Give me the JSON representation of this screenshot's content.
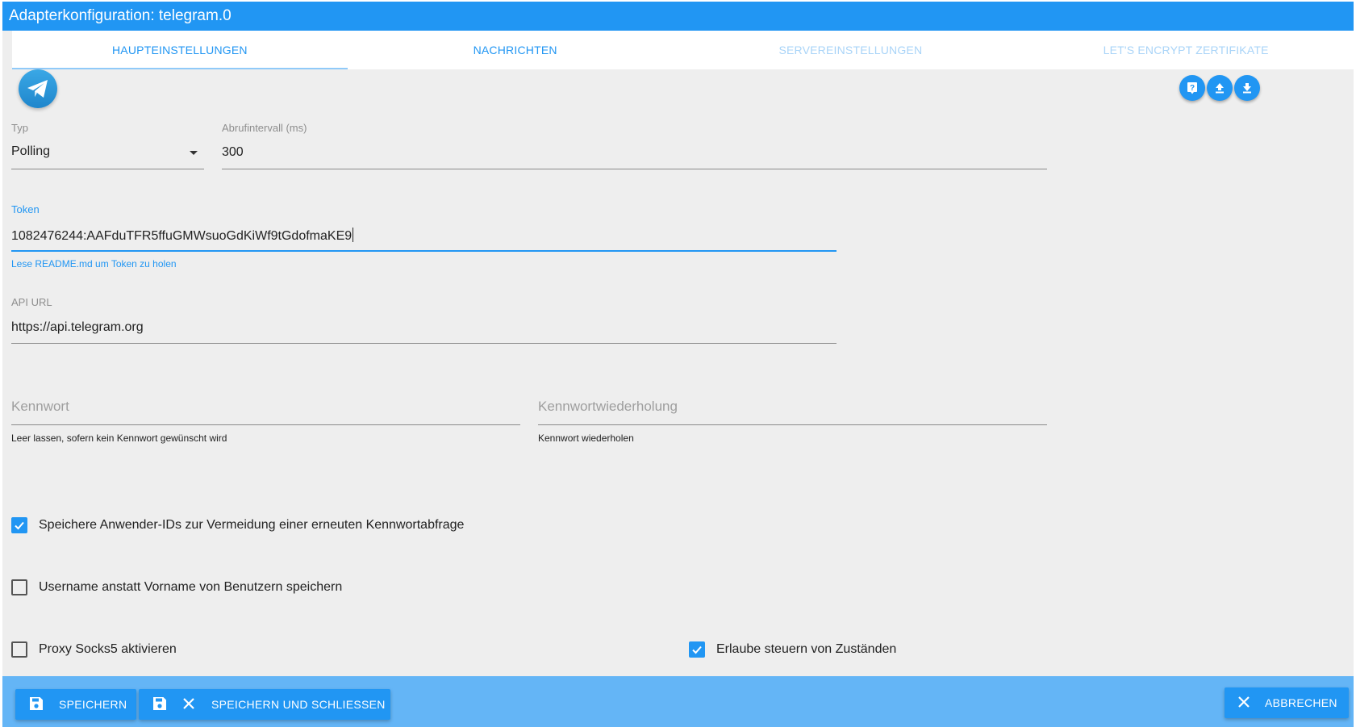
{
  "window": {
    "title": "Adapterkonfiguration: telegram.0"
  },
  "tabs": [
    {
      "label": "HAUPTEINSTELLUNGEN",
      "active": true,
      "enabled": true
    },
    {
      "label": "NACHRICHTEN",
      "active": false,
      "enabled": true
    },
    {
      "label": "SERVEREINSTELLUNGEN",
      "active": false,
      "enabled": false
    },
    {
      "label": "LET'S ENCRYPT ZERTIFIKATE",
      "active": false,
      "enabled": false
    }
  ],
  "toolbar": {
    "icons": [
      "help-icon",
      "upload-icon",
      "download-icon"
    ]
  },
  "form": {
    "typ": {
      "label": "Typ",
      "value": "Polling"
    },
    "interval": {
      "label": "Abrufintervall (ms)",
      "value": "300"
    },
    "token": {
      "label": "Token",
      "value": "1082476244:AAFduTFR5ffuGMWsuoGdKiWf9tGdofmaKE9",
      "helper": "Lese README.md um Token zu holen"
    },
    "api_url": {
      "label": "API URL",
      "value": "https://api.telegram.org"
    },
    "password": {
      "placeholder": "Kennwort",
      "helper": "Leer lassen, sofern kein Kennwort gewünscht wird"
    },
    "password_repeat": {
      "placeholder": "Kennwortwiederholung",
      "helper": "Kennwort wiederholen"
    },
    "checkboxes": {
      "save_ids": {
        "label": "Speichere Anwender-IDs zur Vermeidung einer erneuten Kennwortabfrage",
        "checked": true
      },
      "username": {
        "label": "Username anstatt Vorname von Benutzern speichern",
        "checked": false
      },
      "proxy": {
        "label": "Proxy Socks5 aktivieren",
        "checked": false
      },
      "allow_states": {
        "label": "Erlaube steuern von Zuständen",
        "checked": true
      }
    }
  },
  "footer": {
    "save_label": "SPEICHERN",
    "save_close_label": "SPEICHERN UND SCHLIESSEN",
    "cancel_label": "ABBRECHEN"
  },
  "colors": {
    "primary": "#2196f3",
    "footer": "#64b5f6",
    "background": "#eeeeee"
  }
}
